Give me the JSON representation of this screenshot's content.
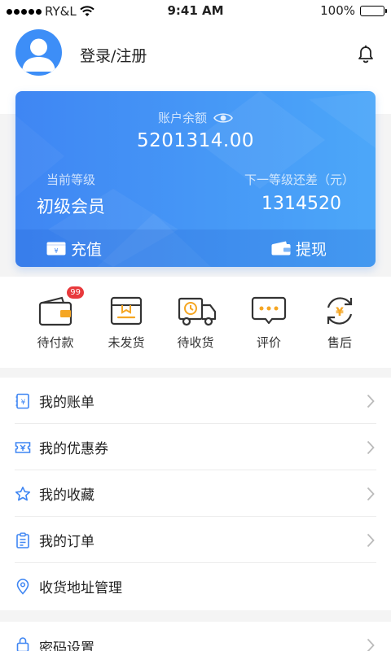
{
  "status": {
    "carrier": "RY&L",
    "time": "9:41 AM",
    "battery": "100%"
  },
  "header": {
    "username": "登录/注册"
  },
  "card": {
    "balance_label": "账户余额",
    "balance": "5201314.00",
    "level_label": "当前等级",
    "level_value": "初级会员",
    "next_label": "下一等级还差（元）",
    "next_value": "1314520",
    "recharge": "充值",
    "withdraw": "提现"
  },
  "orders": {
    "pending_payment": "待付款",
    "pending_payment_badge": "99",
    "not_shipped": "未发货",
    "pending_receipt": "待收货",
    "review": "评价",
    "after_sales": "售后"
  },
  "menu": [
    {
      "label": "我的账单"
    },
    {
      "label": "我的优惠券"
    },
    {
      "label": "我的收藏"
    },
    {
      "label": "我的订单"
    },
    {
      "label": "收货地址管理"
    }
  ],
  "menu2": [
    {
      "label": "密码设置"
    }
  ],
  "colors": {
    "accent": "#3f86f3",
    "icon_orange": "#f5a623",
    "badge": "#e8393c"
  }
}
